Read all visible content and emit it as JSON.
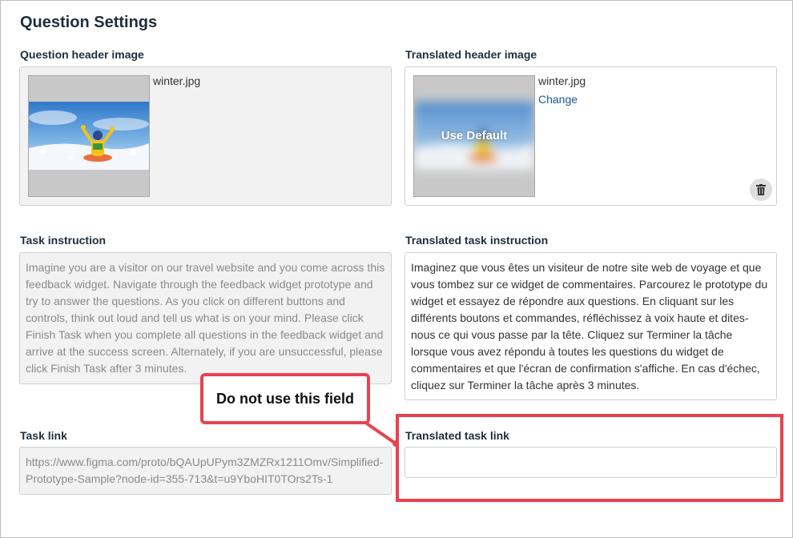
{
  "page": {
    "title": "Question Settings"
  },
  "header_image": {
    "label": "Question header image",
    "filename": "winter.jpg"
  },
  "translated_header_image": {
    "label": "Translated header image",
    "filename": "winter.jpg",
    "change_label": "Change",
    "overlay_label": "Use Default"
  },
  "task_instruction": {
    "label": "Task instruction",
    "lines": [
      "Imagine you are a visitor on our travel website and you come across this",
      "feedback widget. Navigate through the feedback widget prototype and",
      "try to answer the questions. As you click on different buttons and",
      "controls, think out loud and tell us what is on your mind. Please click",
      "Finish Task when you complete all questions in the feedback widget and",
      "arrive at the success screen. Alternately, if you are unsuccessful, please",
      "click Finish Task after 3 minutes."
    ]
  },
  "translated_task_instruction": {
    "label": "Translated task instruction",
    "lines": [
      "Imaginez que vous êtes un visiteur de notre site web de voyage et que",
      "vous tombez sur ce widget de commentaires. Parcourez le prototype du",
      "widget et essayez de répondre aux questions. En cliquant sur les",
      "différents boutons et commandes, réfléchissez à voix haute et dites-",
      "nous ce qui vous passe par la tête. Cliquez sur Terminer la tâche",
      "lorsque vous avez répondu à toutes les questions du widget de",
      "commentaires et que l'écran de confirmation s'affiche. En cas d'échec,",
      "cliquez sur Terminer la tâche après 3 minutes."
    ]
  },
  "task_link": {
    "label": "Task link",
    "lines": [
      "https://www.figma.com/proto/bQAUpUPym3ZMZRx1211Omv/Simplified-",
      "Prototype-Sample?node-id=355-713&t=u9YboHIT0TOrs2Ts-1"
    ]
  },
  "translated_task_link": {
    "label": "Translated task link",
    "value": ""
  },
  "annotation": {
    "callout_text": "Do not use this field",
    "color": "#e8424e"
  },
  "icons": {
    "trash": "trash-icon",
    "photo": "winter-photo"
  }
}
